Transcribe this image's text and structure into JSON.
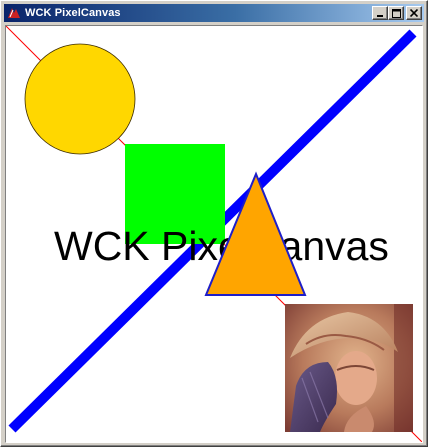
{
  "window": {
    "title": "WCK PixelCanvas",
    "icon": "tk-feather-icon",
    "buttons": [
      "minimize",
      "maximize",
      "close"
    ]
  },
  "canvas": {
    "background": "#ffffff",
    "text": "WCK PixelCanvas",
    "colors": {
      "thin_line": "#ff0000",
      "thick_line": "#0000ff",
      "circle_fill": "#ffd700",
      "square_fill": "#00ff00",
      "triangle_fill": "#ffa500",
      "triangle_outline": "#0000ff"
    },
    "image": {
      "name": "lena-photo"
    }
  }
}
